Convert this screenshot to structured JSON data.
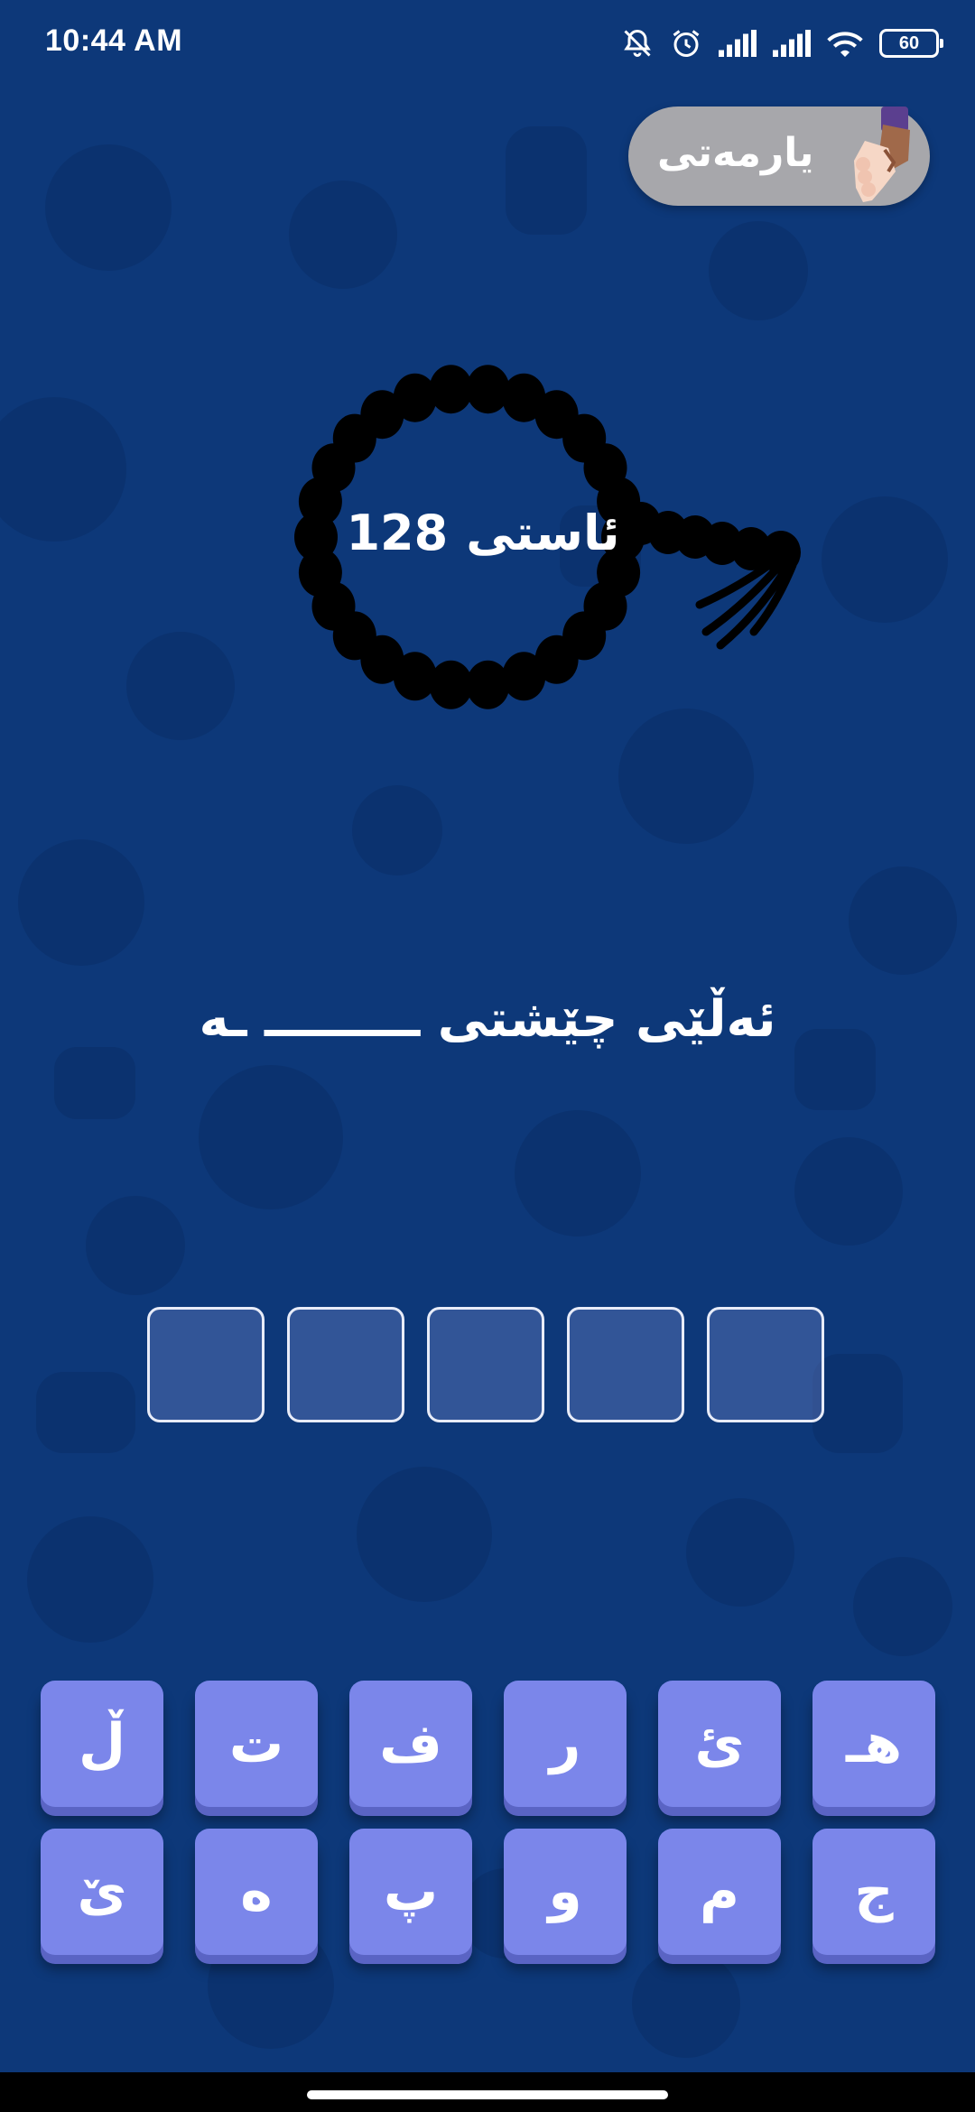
{
  "status_bar": {
    "time": "10:44 AM",
    "battery": "60",
    "icons": [
      "bell-off-icon",
      "alarm-icon",
      "signal-icon",
      "signal-icon",
      "wifi-icon",
      "battery-icon"
    ]
  },
  "help": {
    "label": "یارمەتی",
    "icon": "handshake-icon"
  },
  "level": {
    "label": "ئاستی",
    "number": "128",
    "icon": "rosary-icon"
  },
  "question": {
    "text": "ئەڵێی چێشتی ـــــــــ ـە"
  },
  "answer": {
    "slots": [
      "",
      "",
      "",
      "",
      ""
    ]
  },
  "keyboard": {
    "rows": [
      [
        "ڵ",
        "ت",
        "ف",
        "ر",
        "ئ",
        "ھـ"
      ],
      [
        "ێ",
        "ە",
        "پ",
        "و",
        "م",
        "ج"
      ]
    ]
  },
  "colors": {
    "background": "#0d3879",
    "key": "#7b86ea",
    "help_pill": "#a7a7ab"
  }
}
